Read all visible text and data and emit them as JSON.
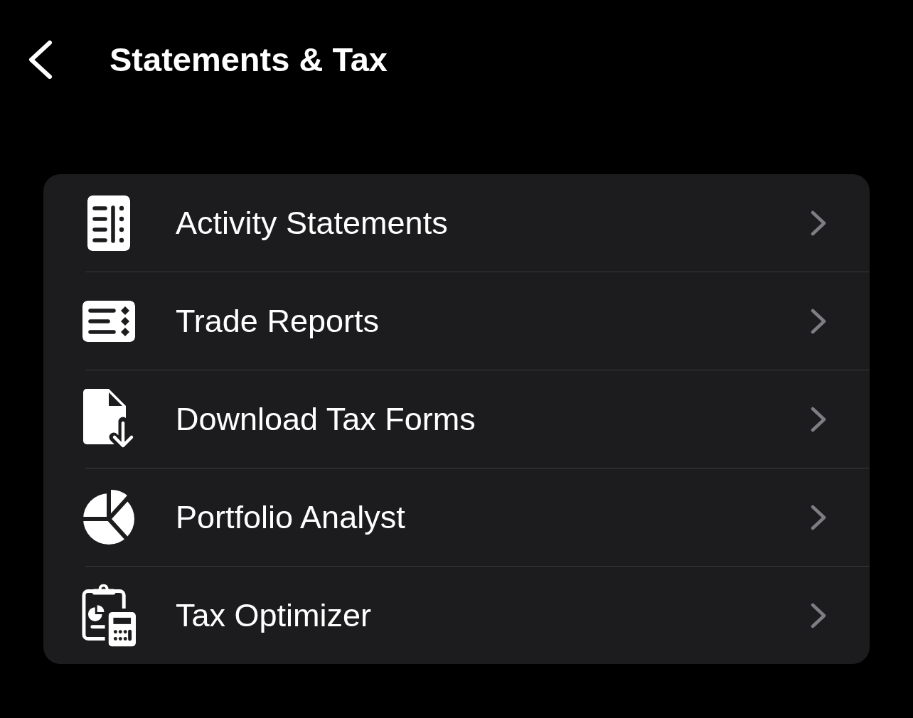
{
  "header": {
    "title": "Statements & Tax"
  },
  "menu": {
    "items": [
      {
        "label": "Activity Statements"
      },
      {
        "label": "Trade Reports"
      },
      {
        "label": "Download Tax Forms"
      },
      {
        "label": "Portfolio Analyst"
      },
      {
        "label": "Tax Optimizer"
      }
    ]
  }
}
